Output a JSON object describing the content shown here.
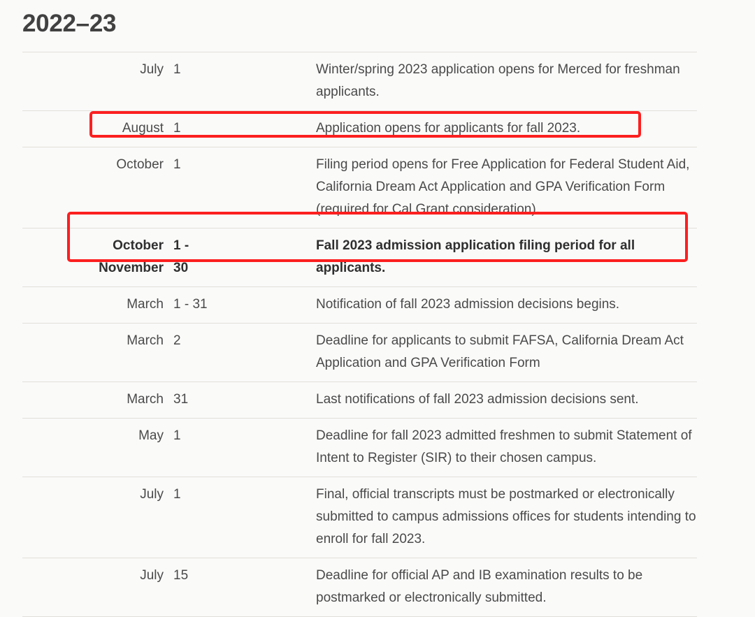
{
  "page": {
    "title": "2022–23",
    "background_color": "#fafaf9",
    "rule_color": "#e2dfda",
    "text_color": "#4a4a4a",
    "highlight_color": "#fc1f1f"
  },
  "table": {
    "rows": [
      {
        "month": "July",
        "day": "1",
        "description": "Winter/spring 2023 application opens for Merced for freshman applicants.",
        "bold": false
      },
      {
        "month": "August",
        "day": "1",
        "description": "Application opens for applicants for fall 2023.",
        "bold": false
      },
      {
        "month": "October",
        "day": "1",
        "description": "Filing period opens for Free Application for Federal Student Aid, California Dream Act Application and GPA Verification Form (required for Cal Grant consideration).",
        "bold": false
      },
      {
        "month": "October\nNovember",
        "day": "1 -\n30",
        "description": "Fall 2023 admission application filing period for all applicants.",
        "bold": true
      },
      {
        "month": "March",
        "day": "1 - 31",
        "description": "Notification of fall 2023 admission decisions begins.",
        "bold": false
      },
      {
        "month": "March",
        "day": "2",
        "description": "Deadline for applicants to submit FAFSA, California Dream Act Application and GPA Verification Form",
        "bold": false
      },
      {
        "month": "March",
        "day": "31",
        "description": "Last notifications of fall 2023 admission decisions sent.",
        "bold": false
      },
      {
        "month": "May",
        "day": "1",
        "description": "Deadline for fall 2023 admitted freshmen to submit Statement of Intent to Register (SIR) to their chosen campus.",
        "bold": false
      },
      {
        "month": "July",
        "day": "1",
        "description": "Final, official transcripts must be postmarked or electronically submitted to campus admissions offices for students intending to enroll for fall 2023.",
        "bold": false
      },
      {
        "month": "July",
        "day": "15",
        "description": "Deadline for official AP and IB examination results to be postmarked or electronically submitted.",
        "bold": false
      }
    ]
  },
  "annotations": [
    {
      "label": "highlight-box-august-row",
      "target_row": 1
    },
    {
      "label": "highlight-box-filing-period-row",
      "target_row": 3
    }
  ]
}
